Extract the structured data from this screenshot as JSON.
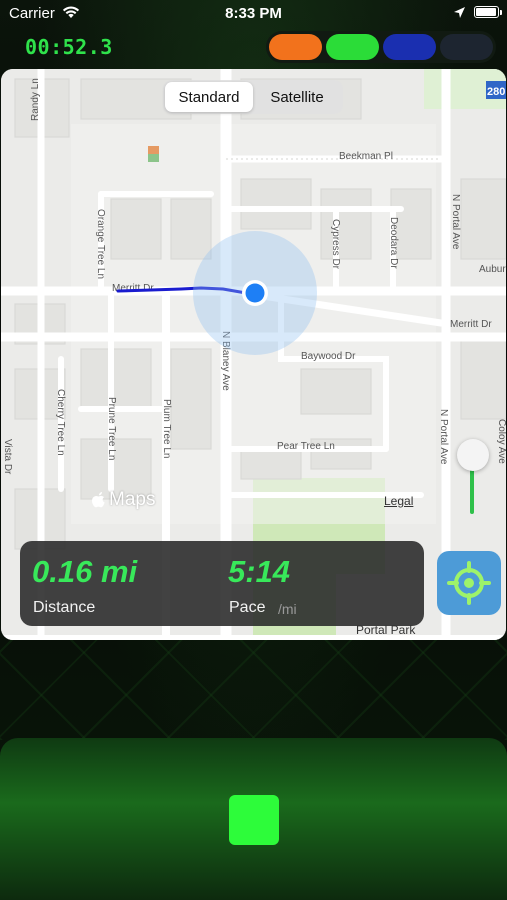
{
  "status_bar": {
    "carrier": "Carrier",
    "time": "8:33 PM",
    "battery_level": 1.0
  },
  "workout": {
    "timer": "00:52.3",
    "color_pills": [
      "#f2721c",
      "#2bdc38",
      "#1a2fb0",
      "#1d2530"
    ]
  },
  "map": {
    "type_options": [
      "Standard",
      "Satellite"
    ],
    "selected_type": "Standard",
    "streets": {
      "beekman": "Beekman Pl",
      "merritt_w": "Merritt Dr",
      "merritt_e": "Merritt Dr",
      "auburn": "Auburn",
      "baywood": "Baywood Dr",
      "pear_tree": "Pear Tree Ln",
      "orange_tree": "Orange Tree Ln",
      "randy": "Randy Ln",
      "cypress": "Cypress Dr",
      "deodara": "Deodara Dr",
      "n_portal_1": "N Portal Ave",
      "n_portal_2": "N Portal Ave",
      "n_blaney": "N Blaney Ave",
      "plum_tree": "Plum Tree Ln",
      "prune_tree": "Prune Tree Ln",
      "cherry_tree": "Cherry Tree Ln",
      "vista": "Vista Dr",
      "coloy": "Coloy Ave",
      "portal_park": "Portal Park",
      "highway_shield": "280"
    },
    "attribution": "Maps",
    "legal": "Legal",
    "route_color": "#1a1ccf",
    "location_dot_color": "#1e7ff5"
  },
  "stats": {
    "distance_value": "0.16 mi",
    "distance_label": "Distance",
    "pace_value": "5:14",
    "pace_label": "Pace",
    "pace_unit": "/mi"
  },
  "controls": {
    "locate_icon": "crosshair-icon",
    "stop_icon": "stop-square-icon",
    "accent_color": "#2dfc3a"
  }
}
